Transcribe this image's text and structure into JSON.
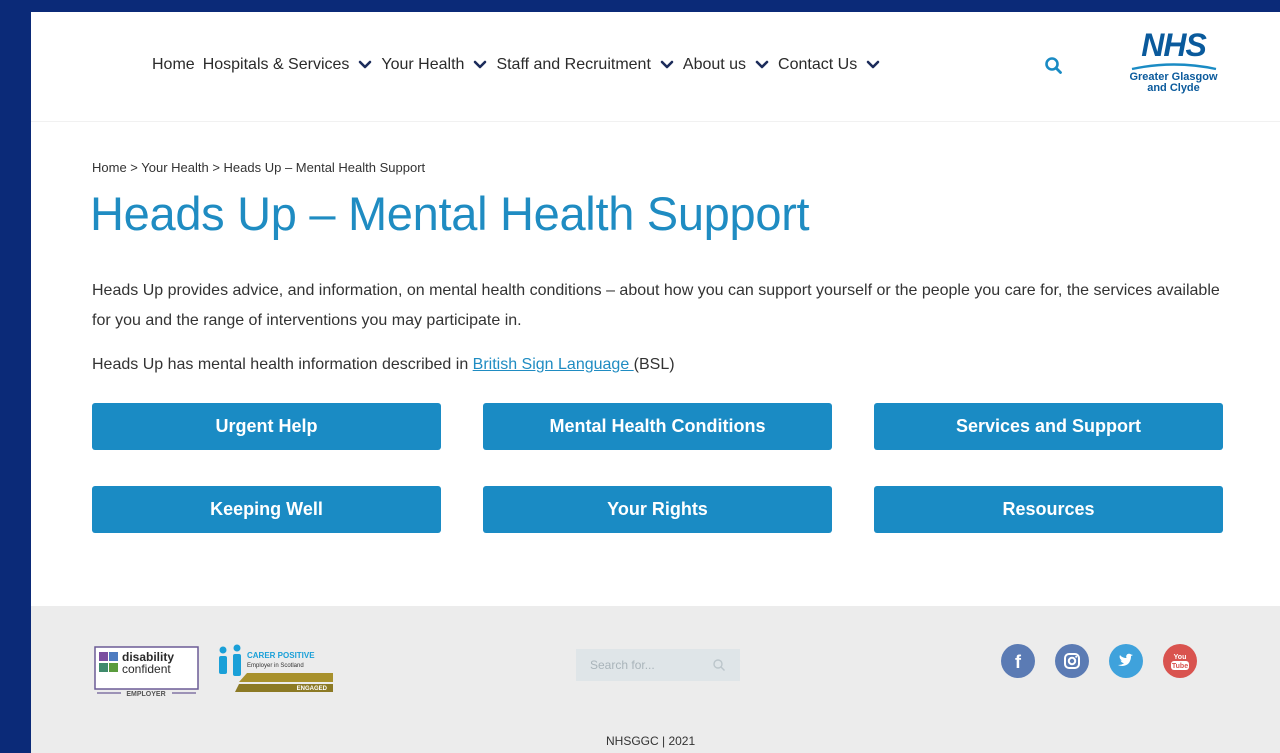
{
  "nav": {
    "items": [
      {
        "label": "Home",
        "dropdown": false
      },
      {
        "label": "Hospitals & Services",
        "dropdown": true
      },
      {
        "label": "Your Health",
        "dropdown": true
      },
      {
        "label": "Staff and Recruitment",
        "dropdown": true
      },
      {
        "label": "About us",
        "dropdown": true
      },
      {
        "label": "Contact Us",
        "dropdown": true
      }
    ],
    "search_icon": "search-icon"
  },
  "logo": {
    "nhs": "NHS",
    "line1": "Greater Glasgow",
    "line2": "and Clyde"
  },
  "breadcrumb": {
    "text": "Home > Your Health > Heads Up – Mental Health Support"
  },
  "main": {
    "title": "Heads Up – Mental Health Support",
    "intro": "Heads Up provides advice, and information, on mental health conditions – about how you can support yourself or the people you care for, the services available for you and the range of interventions you may participate in.",
    "bsl_prefix": "Heads Up has mental health information described in ",
    "bsl_link": "British Sign Language ",
    "bsl_suffix": "(BSL)",
    "buttons": [
      {
        "label": "Urgent Help"
      },
      {
        "label": "Mental Health Conditions"
      },
      {
        "label": "Services and Support"
      },
      {
        "label": "Keeping Well"
      },
      {
        "label": "Your Rights"
      },
      {
        "label": "Resources"
      }
    ]
  },
  "footer": {
    "search_placeholder": "Search for...",
    "copyright": "NHSGGC | 2021",
    "disability_badge": {
      "line1": "disability",
      "line2": "confident",
      "line3": "EMPLOYER"
    },
    "carer_badge": {
      "line1": "CARER POSITIVE",
      "line2": "Employer in Scotland",
      "line3": "ENGAGED"
    },
    "social": [
      {
        "name": "facebook",
        "glyph": "f",
        "color": "#5b7bb4"
      },
      {
        "name": "instagram",
        "glyph": "◎",
        "color": "#5b7bb4"
      },
      {
        "name": "twitter",
        "glyph": "t",
        "color": "#3fa2dc"
      },
      {
        "name": "youtube",
        "glyph": "You\nTube",
        "color": "#d9534f"
      }
    ]
  },
  "colors": {
    "frame": "#0b2a78",
    "accent": "#1a8bc4",
    "title": "#1f8cc2",
    "footer_bg": "#ececec"
  }
}
